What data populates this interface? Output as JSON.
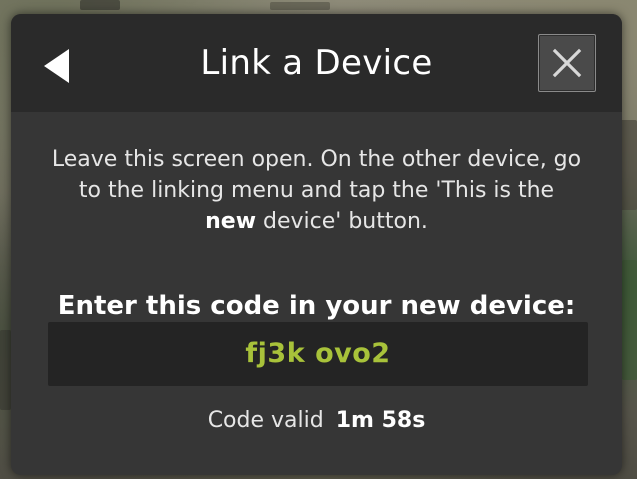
{
  "dialog": {
    "title": "Link a Device",
    "back_icon": "back-arrow-icon",
    "close_icon": "close-icon",
    "instructions": {
      "part1": "Leave this screen open. On the other device, go to the linking menu and tap the 'This is the ",
      "emphasis": "new",
      "part2": " device' button."
    },
    "code_heading": "Enter this code in your new device:",
    "code": "fj3k ovo2",
    "validity_label": "Code valid",
    "validity_time": "1m 58s"
  },
  "colors": {
    "panel_background": "#363636",
    "header_background": "#2a2a2a",
    "code_box_background": "#242424",
    "code_text": "#a8c23a",
    "text_primary": "#ffffff"
  }
}
